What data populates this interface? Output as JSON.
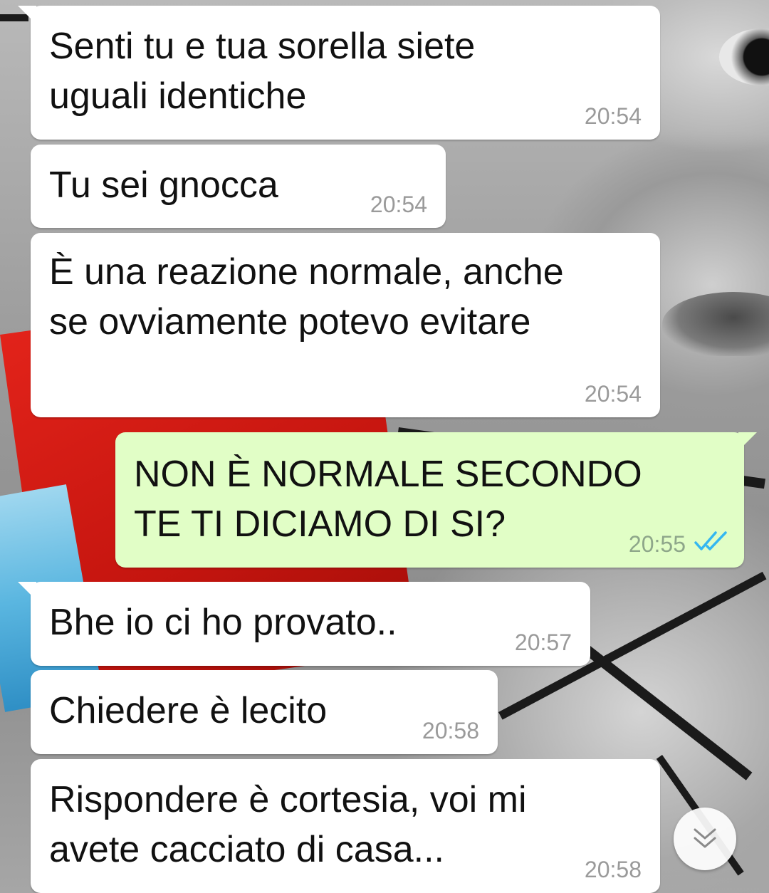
{
  "messages": [
    {
      "direction": "incoming",
      "text": "Senti tu e tua sorella siete\nuguali identiche",
      "time": "20:54"
    },
    {
      "direction": "incoming",
      "text": "Tu sei gnocca",
      "time": "20:54"
    },
    {
      "direction": "incoming",
      "text": "È una reazione normale, anche\nse ovviamente potevo evitare",
      "time": "20:54"
    },
    {
      "direction": "outgoing",
      "text": "NON È NORMALE SECONDO\nTE TI DICIAMO DI SI?",
      "time": "20:55",
      "status": "read"
    },
    {
      "direction": "incoming",
      "text": "Bhe io ci ho provato..",
      "time": "20:57"
    },
    {
      "direction": "incoming",
      "text": "Chiedere è lecito",
      "time": "20:58"
    },
    {
      "direction": "incoming",
      "text": "Rispondere è cortesia, voi mi\navete cacciato di casa...",
      "time": "20:58"
    }
  ],
  "colors": {
    "incoming_bubble": "#ffffff",
    "outgoing_bubble": "#e1fec6",
    "read_ticks": "#34b7f1",
    "time_text": "#9a9a9a"
  },
  "icons": {
    "read_receipt": "double-check-icon",
    "scroll_down": "double-chevron-down-icon"
  }
}
